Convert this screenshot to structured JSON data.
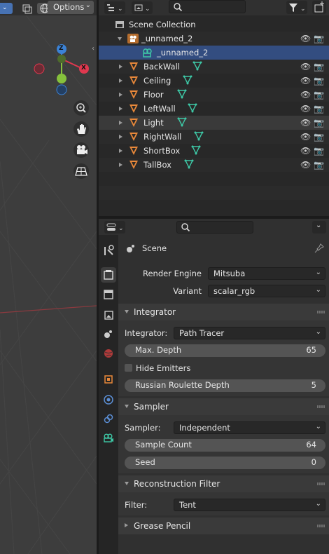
{
  "viewport": {
    "options_label": "Options",
    "gizmo": {
      "z": "Z",
      "y": "Y",
      "x": "X"
    },
    "nav_icons": [
      "zoom-icon",
      "hand-pan-icon",
      "camera-view-icon",
      "grid-view-icon"
    ]
  },
  "outliner": {
    "search_placeholder": "",
    "rows": [
      {
        "label": "Scene Collection"
      },
      {
        "label": "_unnamed_2"
      },
      {
        "label": "_unnamed_2"
      },
      {
        "label": "BackWall"
      },
      {
        "label": "Ceiling"
      },
      {
        "label": "Floor"
      },
      {
        "label": "LeftWall"
      },
      {
        "label": "Light"
      },
      {
        "label": "RightWall"
      },
      {
        "label": "ShortBox"
      },
      {
        "label": "TallBox"
      }
    ]
  },
  "properties": {
    "search_placeholder": "",
    "context_title": "Scene",
    "render_engine_label": "Render Engine",
    "render_engine_value": "Mitsuba",
    "variant_label": "Variant",
    "variant_value": "scalar_rgb",
    "integrator_panel": {
      "title": "Integrator",
      "integrator_label": "Integrator:",
      "integrator_value": "Path Tracer",
      "max_depth_label": "Max. Depth",
      "max_depth_value": "65",
      "hide_emitters_label": "Hide Emitters",
      "rr_depth_label": "Russian Roulette Depth",
      "rr_depth_value": "5"
    },
    "sampler_panel": {
      "title": "Sampler",
      "sampler_label": "Sampler:",
      "sampler_value": "Independent",
      "sample_count_label": "Sample Count",
      "sample_count_value": "64",
      "seed_label": "Seed",
      "seed_value": "0"
    },
    "recon_panel": {
      "title": "Reconstruction Filter",
      "filter_label": "Filter:",
      "filter_value": "Tent"
    },
    "grease_pencil_panel": {
      "title": "Grease Pencil"
    }
  },
  "colors": {
    "selection": "#334d80",
    "mesh_orange": "#e8883a",
    "mesh_green": "#3ec8a6",
    "axis_x": "#e0384f",
    "axis_y": "#86c13c",
    "axis_z": "#3b82d6"
  }
}
